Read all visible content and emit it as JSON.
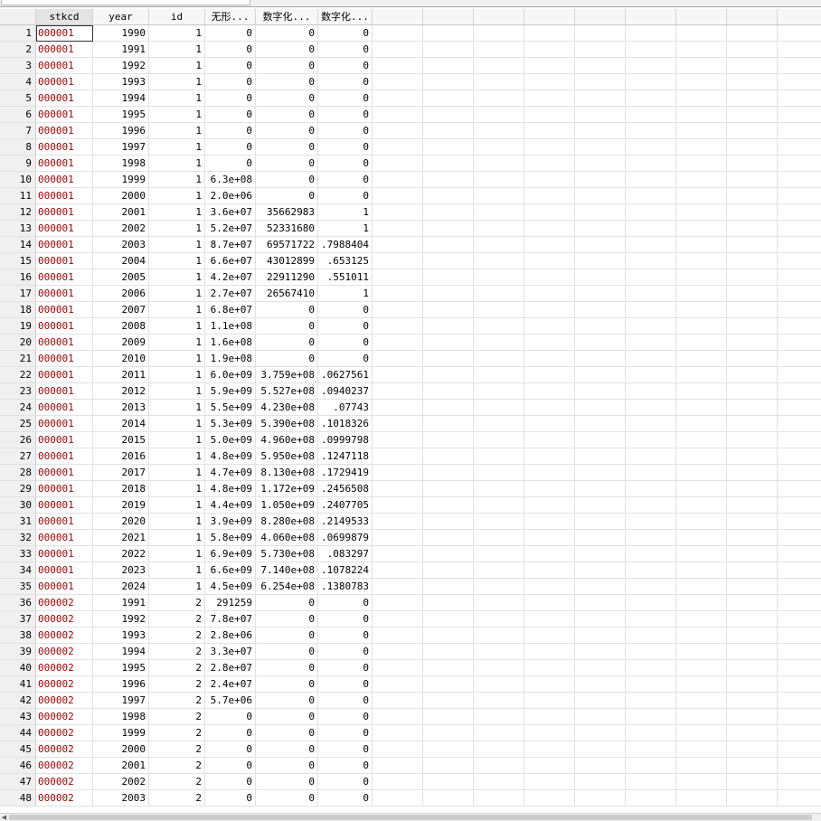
{
  "columns": [
    {
      "key": "stkcd",
      "label": "stkcd",
      "type": "str"
    },
    {
      "key": "year",
      "label": "year",
      "type": "num"
    },
    {
      "key": "id",
      "label": "id",
      "type": "num"
    },
    {
      "key": "intangible",
      "label": "无形...",
      "type": "num"
    },
    {
      "key": "digital1",
      "label": "数字化...",
      "type": "num"
    },
    {
      "key": "digital2",
      "label": "数字化...",
      "type": "num"
    }
  ],
  "rows": [
    [
      "000001",
      "1990",
      "1",
      "0",
      "0",
      "0"
    ],
    [
      "000001",
      "1991",
      "1",
      "0",
      "0",
      "0"
    ],
    [
      "000001",
      "1992",
      "1",
      "0",
      "0",
      "0"
    ],
    [
      "000001",
      "1993",
      "1",
      "0",
      "0",
      "0"
    ],
    [
      "000001",
      "1994",
      "1",
      "0",
      "0",
      "0"
    ],
    [
      "000001",
      "1995",
      "1",
      "0",
      "0",
      "0"
    ],
    [
      "000001",
      "1996",
      "1",
      "0",
      "0",
      "0"
    ],
    [
      "000001",
      "1997",
      "1",
      "0",
      "0",
      "0"
    ],
    [
      "000001",
      "1998",
      "1",
      "0",
      "0",
      "0"
    ],
    [
      "000001",
      "1999",
      "1",
      "6.3e+08",
      "0",
      "0"
    ],
    [
      "000001",
      "2000",
      "1",
      "2.0e+06",
      "0",
      "0"
    ],
    [
      "000001",
      "2001",
      "1",
      "3.6e+07",
      "35662983",
      "1"
    ],
    [
      "000001",
      "2002",
      "1",
      "5.2e+07",
      "52331680",
      "1"
    ],
    [
      "000001",
      "2003",
      "1",
      "8.7e+07",
      "69571722",
      ".7988404"
    ],
    [
      "000001",
      "2004",
      "1",
      "6.6e+07",
      "43012899",
      ".653125"
    ],
    [
      "000001",
      "2005",
      "1",
      "4.2e+07",
      "22911290",
      ".551011"
    ],
    [
      "000001",
      "2006",
      "1",
      "2.7e+07",
      "26567410",
      "1"
    ],
    [
      "000001",
      "2007",
      "1",
      "6.8e+07",
      "0",
      "0"
    ],
    [
      "000001",
      "2008",
      "1",
      "1.1e+08",
      "0",
      "0"
    ],
    [
      "000001",
      "2009",
      "1",
      "1.6e+08",
      "0",
      "0"
    ],
    [
      "000001",
      "2010",
      "1",
      "1.9e+08",
      "0",
      "0"
    ],
    [
      "000001",
      "2011",
      "1",
      "6.0e+09",
      "3.759e+08",
      ".0627561"
    ],
    [
      "000001",
      "2012",
      "1",
      "5.9e+09",
      "5.527e+08",
      ".0940237"
    ],
    [
      "000001",
      "2013",
      "1",
      "5.5e+09",
      "4.230e+08",
      ".07743"
    ],
    [
      "000001",
      "2014",
      "1",
      "5.3e+09",
      "5.390e+08",
      ".1018326"
    ],
    [
      "000001",
      "2015",
      "1",
      "5.0e+09",
      "4.960e+08",
      ".0999798"
    ],
    [
      "000001",
      "2016",
      "1",
      "4.8e+09",
      "5.950e+08",
      ".1247118"
    ],
    [
      "000001",
      "2017",
      "1",
      "4.7e+09",
      "8.130e+08",
      ".1729419"
    ],
    [
      "000001",
      "2018",
      "1",
      "4.8e+09",
      "1.172e+09",
      ".2456508"
    ],
    [
      "000001",
      "2019",
      "1",
      "4.4e+09",
      "1.050e+09",
      ".2407705"
    ],
    [
      "000001",
      "2020",
      "1",
      "3.9e+09",
      "8.280e+08",
      ".2149533"
    ],
    [
      "000001",
      "2021",
      "1",
      "5.8e+09",
      "4.060e+08",
      ".0699879"
    ],
    [
      "000001",
      "2022",
      "1",
      "6.9e+09",
      "5.730e+08",
      ".083297"
    ],
    [
      "000001",
      "2023",
      "1",
      "6.6e+09",
      "7.140e+08",
      ".1078224"
    ],
    [
      "000001",
      "2024",
      "1",
      "4.5e+09",
      "6.254e+08",
      ".1380783"
    ],
    [
      "000002",
      "1991",
      "2",
      "291259",
      "0",
      "0"
    ],
    [
      "000002",
      "1992",
      "2",
      "7.8e+07",
      "0",
      "0"
    ],
    [
      "000002",
      "1993",
      "2",
      "2.8e+06",
      "0",
      "0"
    ],
    [
      "000002",
      "1994",
      "2",
      "3.3e+07",
      "0",
      "0"
    ],
    [
      "000002",
      "1995",
      "2",
      "2.8e+07",
      "0",
      "0"
    ],
    [
      "000002",
      "1996",
      "2",
      "2.4e+07",
      "0",
      "0"
    ],
    [
      "000002",
      "1997",
      "2",
      "5.7e+06",
      "0",
      "0"
    ],
    [
      "000002",
      "1998",
      "2",
      "0",
      "0",
      "0"
    ],
    [
      "000002",
      "1999",
      "2",
      "0",
      "0",
      "0"
    ],
    [
      "000002",
      "2000",
      "2",
      "0",
      "0",
      "0"
    ],
    [
      "000002",
      "2001",
      "2",
      "0",
      "0",
      "0"
    ],
    [
      "000002",
      "2002",
      "2",
      "0",
      "0",
      "0"
    ],
    [
      "000002",
      "2003",
      "2",
      "0",
      "0",
      "0"
    ]
  ],
  "selected_column": "stkcd",
  "active_row": 1
}
